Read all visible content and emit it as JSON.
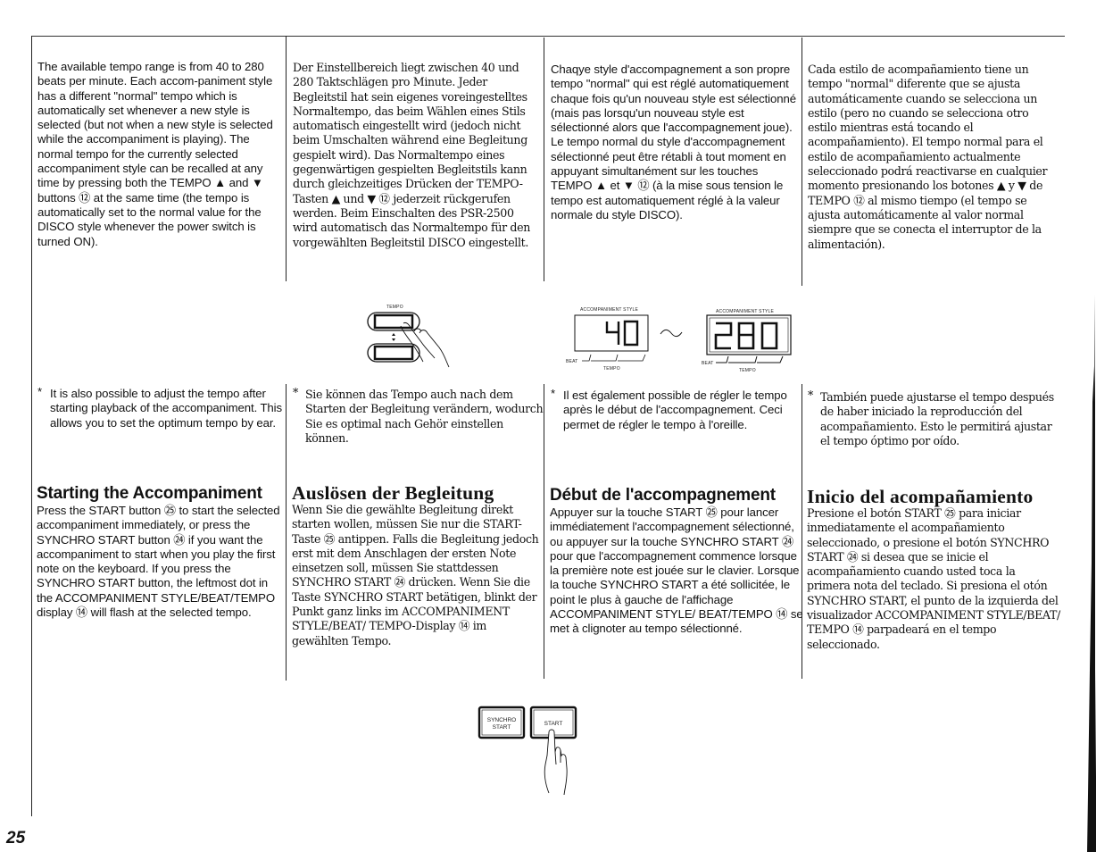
{
  "page_number": "25",
  "top_section": {
    "english": "The available tempo range is from 40 to 280 beats per minute. Each accom-paniment style has a different \"normal\" tempo which is automatically set whenever a new style is selected (but not when a new style is selected while the accompaniment is playing). The normal tempo for the currently selected accompaniment style can be recalled at any time by pressing both the TEMPO ▲ and ▼ buttons ⑫ at the same time (the tempo is automatically set to the normal value for the DISCO style whenever the power switch is turned ON).",
    "german": "Der Einstellbereich liegt zwischen 40 und 280 Taktschlägen pro Minute. Jeder Begleitstil hat sein eigenes voreingestelltes Normaltempo, das beim Wählen eines Stils automatisch eingestellt wird (jedoch nicht beim Umschalten während eine Begleitung gespielt wird). Das Normaltempo eines gegenwärtigen gespielten Begleitstils kann durch gleichzeitiges Drücken der TEMPO-Tasten ▲ und ▼ ⑫ jederzeit rückgerufen werden. Beim Einschalten des PSR-2500 wird automatisch das Normaltempo für den vorgewählten Begleitstil DISCO eingestellt.",
    "french": "Chaqye style d'accompagnement a son propre tempo \"normal\" qui est réglé automatiquement chaque fois qu'un nouveau style est sélectionné (mais pas lorsqu'un nouveau style est sélectionné alors que l'accompagnement joue). Le tempo normal du style d'accompagnement sélectionné peut être rétabli à tout moment en appuyant simultanément sur les touches TEMPO ▲ et ▼ ⑫ (à la mise sous tension le tempo est automatiquement réglé à la valeur normale du style DISCO).",
    "spanish": "Cada estilo de acompañamiento tiene un tempo \"normal\" diferente que se ajusta automáticamente cuando se selecciona un estilo (pero no cuando se selecciona otro estilo mientras está tocando el acompañamiento).  El tempo normal para el estilo de acompañamiento actualmente seleccionado podrá reactivarse en cualquier momento presionando los botones ▲ y ▼ de TEMPO ⑫ al mismo tiempo (el tempo se ajusta automáticamente al valor normal siempre que se conecta el interruptor de la alimentación)."
  },
  "tempo_illustration": {
    "buttons_label": "TEMPO",
    "arrows": "▲▼",
    "display_label": "ACCOMPANIMENT STYLE",
    "display_min": "40",
    "display_max": "280",
    "range_separator": "~",
    "beat_label": "BEAT",
    "tempo_label": "TEMPO"
  },
  "notes": {
    "star": "*",
    "english": "It is also possible to adjust the tempo after starting playback of the accompaniment. This allows you to set the optimum tempo by ear.",
    "german": "Sie können das Tempo auch nach dem Starten der Begleitung verändern, wodurch Sie es optimal nach Gehör einstellen können.",
    "french": "Il est également possible de régler le tempo après le début de l'accompagnement. Ceci permet de régler le tempo à l'oreille.",
    "spanish": "También puede ajustarse el tempo después de haber iniciado la reproducción del acompañamiento. Esto le permitirá ajustar el tempo óptimo por oído."
  },
  "start_section": {
    "english": {
      "heading": "Starting the Accompaniment",
      "body": "Press the START button ㉕ to start the selected accompaniment immediately, or press the SYNCHRO START button ㉔ if you want the accompaniment to start when you play the first note on the keyboard. If you press the SYNCHRO START button, the leftmost dot in the ACCOMPANIMENT STYLE/BEAT/TEMPO display ⑭ will flash at the selected tempo."
    },
    "german": {
      "heading": "Auslösen der Begleitung",
      "body": "Wenn Sie die gewählte Begleitung direkt starten wollen, müssen Sie nur die START-Taste ㉕ antippen. Falls die Begleitung jedoch erst mit dem Anschlagen der ersten Note einsetzen soll, müssen Sie stattdessen SYNCHRO START ㉔ drücken. Wenn Sie die Taste SYNCHRO START betätigen, blinkt der Punkt ganz links im ACCOMPANIMENT STYLE/BEAT/ TEMPO-Display ⑭ im gewählten Tempo."
    },
    "french": {
      "heading": "Début de l'accompagnement",
      "body": "Appuyer sur la touche START ㉕ pour lancer immédiatement l'accompagnement sélectionné, ou appuyer sur la touche SYNCHRO START ㉔ pour que l'accompagnement commence lorsque la première note est jouée sur le clavier. Lorsque la touche SYNCHRO START a été sollicitée, le point le plus à gauche de l'affichage ACCOMPANIMENT STYLE/ BEAT/TEMPO ⑭ se met à clignoter au tempo sélectionné."
    },
    "spanish": {
      "heading": "Inicio del acompañamiento",
      "body": "Presione el botón START ㉕ para iniciar inmediatamente el acompañamiento seleccionado, o presione el botón SYNCHRO START ㉔ si desea que se inicie el acompañamiento cuando usted toca la primera nota del teclado. Si presiona el otón SYNCHRO START, el punto de la izquierda del visualizador ACCOMPANIMENT STYLE/BEAT/ TEMPO ⑭ parpadeará en el tempo seleccionado."
    }
  },
  "start_illustration": {
    "synchro_line1": "SYNCHRO",
    "synchro_line2": "START",
    "start_label": "START"
  }
}
